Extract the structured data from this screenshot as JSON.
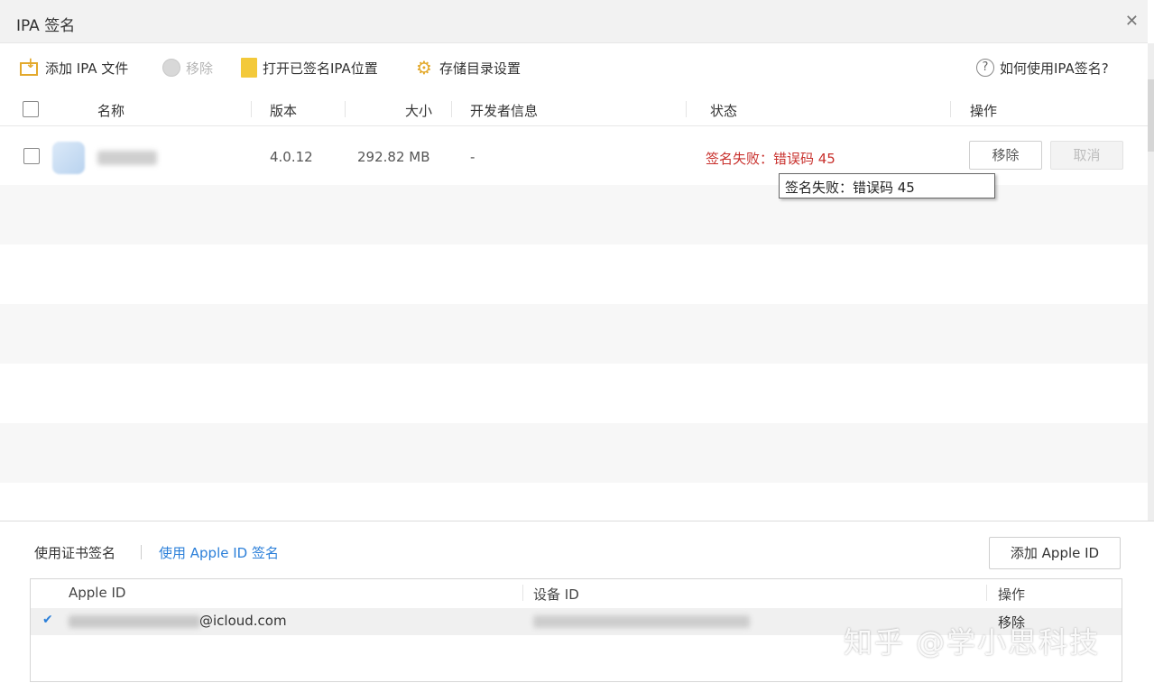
{
  "window": {
    "title": "IPA 签名",
    "close_icon": "close-icon"
  },
  "toolbar": {
    "add_ipa_label": "添加 IPA 文件",
    "remove_label": "移除",
    "open_signed_location_label": "打开已签名IPA位置",
    "storage_settings_label": "存储目录设置",
    "help_label": "如何使用IPA签名?",
    "accent_color": "#e3a92c"
  },
  "grid": {
    "columns": {
      "name": "名称",
      "version": "版本",
      "size": "大小",
      "developer": "开发者信息",
      "status": "状态",
      "actions": "操作"
    },
    "rows": [
      {
        "version": "4.0.12",
        "size": "292.82 MB",
        "developer": "-",
        "status": "签名失败：错误码 45",
        "remove_label": "移除",
        "cancel_label": "取消"
      }
    ],
    "status_error_color": "#c8302c"
  },
  "tooltip": {
    "text": "签名失败：错误码 45"
  },
  "bottom": {
    "tab_certificate": "使用证书签名",
    "tab_apple_id": "使用 Apple ID 签名",
    "add_apple_id_label": "添加 Apple ID",
    "table": {
      "col_apple_id": "Apple ID",
      "col_device_id": "设备 ID",
      "col_actions": "操作",
      "rows": [
        {
          "email_suffix": "@icloud.com",
          "action": "移除"
        }
      ]
    },
    "link_color": "#2b7fd9"
  },
  "watermark": "知乎 @学小思科技"
}
